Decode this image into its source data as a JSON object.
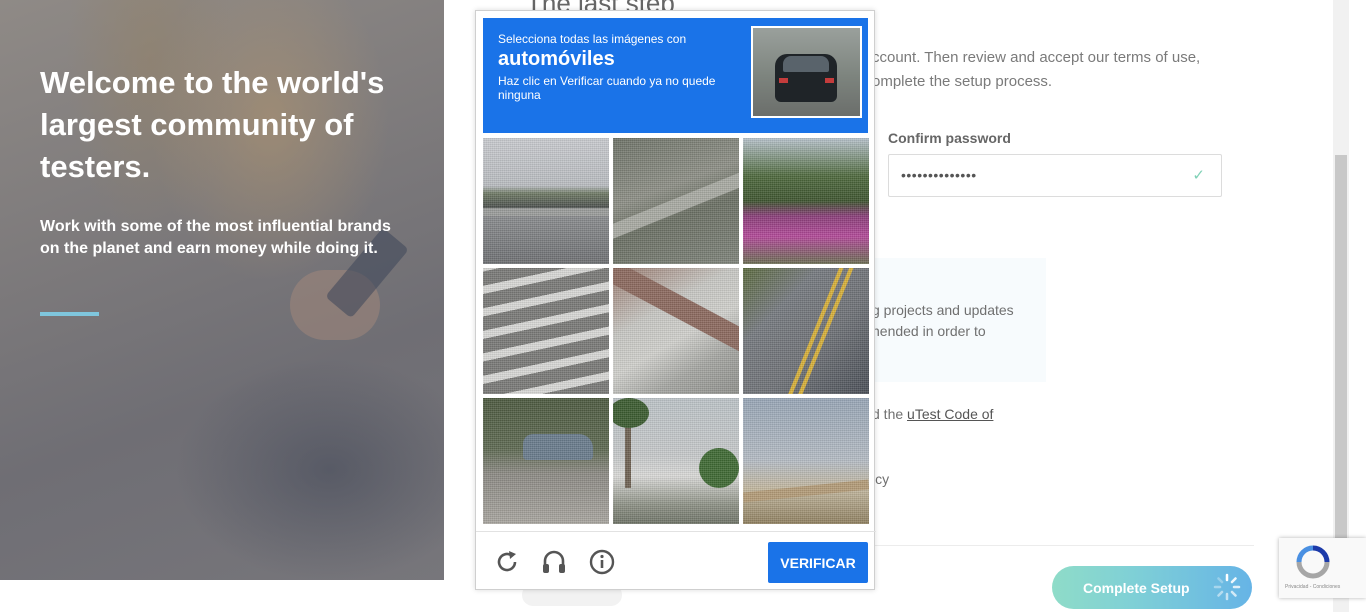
{
  "hero": {
    "title": "Welcome to the world's largest community of testers.",
    "subtitle": "Work with some of the most influential brands on the planet and earn money while doing it."
  },
  "form": {
    "heading": "The last step",
    "intro": "ccount. Then review and accept our terms of use, omplete the setup process.",
    "confirm_label": "Confirm password",
    "confirm_value": "••••••••••••••",
    "info_text": "g projects and updates nended in order to",
    "code_prefix": "d the ",
    "code_link": "uTest Code of",
    "policy_fragment": "icy",
    "complete_button": "Complete Setup"
  },
  "captcha": {
    "instruction_line1": "Selecciona todas las imágenes con",
    "target": "automóviles",
    "instruction_line2": "Haz clic en Verificar cuando ya no quede ninguna",
    "verify_button": "VERIFICAR",
    "tiles": [
      {
        "scene": "highway-overpass"
      },
      {
        "scene": "freeway-aerial"
      },
      {
        "scene": "pink-building-tree"
      },
      {
        "scene": "crosswalk-stripes"
      },
      {
        "scene": "overpass-underside"
      },
      {
        "scene": "road-yellow-lines"
      },
      {
        "scene": "parked-car"
      },
      {
        "scene": "palm-tree-wall"
      },
      {
        "scene": "road-sky-rail"
      }
    ],
    "footer_icons": [
      "reload-icon",
      "audio-icon",
      "info-icon"
    ]
  },
  "recaptcha_badge": {
    "text": "Privacidad - Condiciones"
  }
}
